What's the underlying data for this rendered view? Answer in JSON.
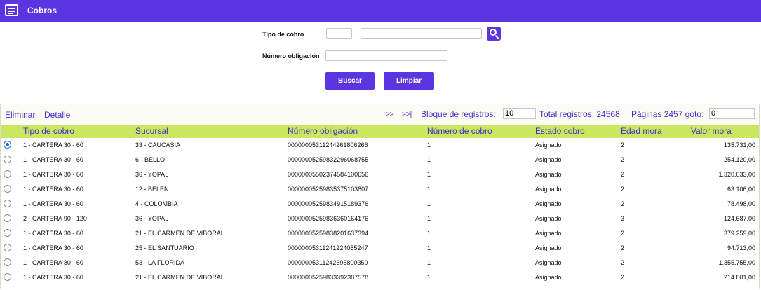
{
  "header": {
    "title": "Cobros",
    "icon": "list-window-icon"
  },
  "form": {
    "tipo_cobro_label": "Tipo de cobro",
    "tipo_cobro_code": "",
    "tipo_cobro_desc": "",
    "numero_obligacion_label": "Número obligación",
    "numero_obligacion_value": ""
  },
  "actions": {
    "buscar": "Buscar",
    "limpiar": "Limpiar"
  },
  "toolbar": {
    "eliminar": "Eliminar",
    "separator": "|",
    "detalle": "Detalle",
    "next": ">>",
    "last": ">>|",
    "bloque_label": "Bloque de registros:",
    "bloque_value": "10",
    "total_label": "Total registros: 24568",
    "paginas_label": "Páginas 2457 goto:",
    "goto_value": "0"
  },
  "table": {
    "headers": [
      "Tipo de cobro",
      "Sucursal",
      "Número obligación",
      "Número de cobro",
      "Estado cobro",
      "Edad mora",
      "Valor mora"
    ],
    "selected_index": 0,
    "rows": [
      [
        "1 - CARTERA 30 - 60",
        "33 - CAUCASIA",
        "000000053112442618062​66",
        "1",
        "Asignado",
        "2",
        "135.731,00"
      ],
      [
        "1 - CARTERA 30 - 60",
        "6 - BELLO",
        "000000052598322960687​55",
        "1",
        "Asignado",
        "2",
        "254.120,00"
      ],
      [
        "1 - CARTERA 30 - 60",
        "36 - YOPAL",
        "000000055023745841006​56",
        "1",
        "Asignado",
        "2",
        "1.320.033,00"
      ],
      [
        "1 - CARTERA 30 - 60",
        "12 - BELÉN",
        "000000052598353751038​07",
        "1",
        "Asignado",
        "2",
        "63.106,00"
      ],
      [
        "1 - CARTERA 30 - 60",
        "4 - COLOMBIA",
        "000000052598349151893​76",
        "1",
        "Asignado",
        "2",
        "78.498,00"
      ],
      [
        "2 - CARTERA 90 - 120",
        "36 - YOPAL",
        "000000052598363601641​76",
        "1",
        "Asignado",
        "3",
        "124.687,00"
      ],
      [
        "1 - CARTERA 30 - 60",
        "21 - EL CARMEN DE VIBORAL",
        "000000052598382016373​94",
        "1",
        "Asignado",
        "2",
        "379.259,00"
      ],
      [
        "1 - CARTERA 30 - 60",
        "25 - EL SANTUARIO",
        "000000053112412240552​47",
        "1",
        "Asignado",
        "2",
        "94.713,00"
      ],
      [
        "1 - CARTERA 30 - 60",
        "53 - LA FLORIDA",
        "000000053112426958003​50",
        "1",
        "Asignado",
        "2",
        "1.355.755,00"
      ],
      [
        "1 - CARTERA 30 - 60",
        "21 - EL CARMEN DE VIBORAL",
        "000000052598333923875​78",
        "1",
        "Asignado",
        "2",
        "214.801,00"
      ]
    ]
  }
}
